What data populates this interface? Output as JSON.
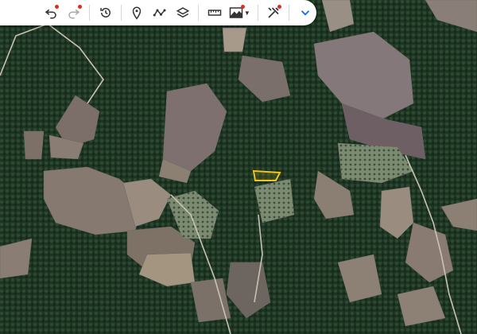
{
  "map": {
    "type": "satellite",
    "parcel_highlight_color": "#f2c318"
  },
  "toolbar": {
    "buttons": [
      {
        "name": "undo-icon",
        "badge": true
      },
      {
        "name": "redo-icon",
        "badge": true,
        "disabled": true
      },
      {
        "name": "history-icon"
      },
      {
        "name": "place-marker-icon"
      },
      {
        "name": "draw-path-icon"
      },
      {
        "name": "layers-icon"
      },
      {
        "name": "ruler-icon"
      },
      {
        "name": "elevation-profile-icon",
        "badge": true,
        "dropdown": true
      },
      {
        "name": "tools-icon",
        "badge": true
      },
      {
        "name": "expand-chevron-icon"
      }
    ],
    "colors": {
      "icon": "#333333",
      "disabled": "#aaaaaa",
      "badge": "#d93025",
      "accent": "#1a73e8"
    }
  }
}
